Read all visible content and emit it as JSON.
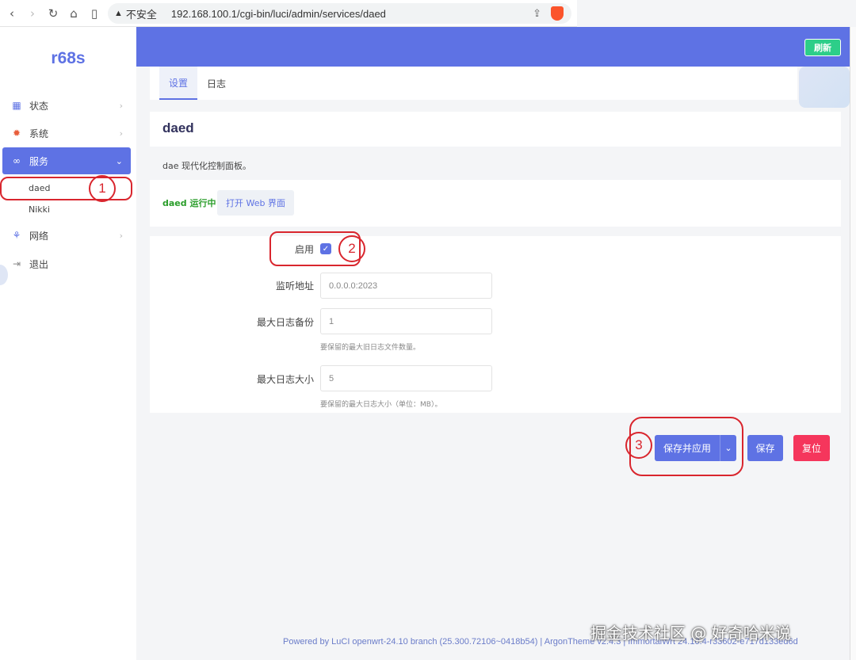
{
  "browser": {
    "insecure_label": "不安全",
    "url": "192.168.100.1/cgi-bin/luci/admin/services/daed"
  },
  "sidebar": {
    "logo": "r68s",
    "items": [
      {
        "label": "状态",
        "icon": "dashboard-icon"
      },
      {
        "label": "系统",
        "icon": "gear-icon"
      },
      {
        "label": "服务",
        "icon": "link-icon"
      },
      {
        "label": "网络",
        "icon": "sitemap-icon"
      },
      {
        "label": "退出",
        "icon": "logout-icon"
      }
    ],
    "sub_items": [
      {
        "label": "daed"
      },
      {
        "label": "Nikki"
      }
    ]
  },
  "header": {
    "refresh_label": "刷新"
  },
  "tabs": [
    {
      "label": "设置",
      "active": true
    },
    {
      "label": "日志",
      "active": false
    }
  ],
  "main": {
    "title": "daed",
    "description": "dae 现代化控制面板。",
    "status_text": "daed 运行中",
    "open_web_label": "打开 Web 界面",
    "form": {
      "enable_label": "启用",
      "enabled": true,
      "listen_label": "监听地址",
      "listen_value": "0.0.0.0:2023",
      "max_backups_label": "最大日志备份",
      "max_backups_value": "1",
      "max_backups_hint": "要保留的最大旧日志文件数量。",
      "max_size_label": "最大日志大小",
      "max_size_value": "5",
      "max_size_hint": "要保留的最大日志大小（单位：MB）。"
    },
    "buttons": {
      "save_apply": "保存并应用",
      "save": "保存",
      "reset": "复位"
    }
  },
  "annotations": [
    "1",
    "2",
    "3"
  ],
  "footer": "Powered by LuCI openwrt-24.10 branch (25.300.72106~0418b54)  |  ArgonTheme v2.4.3  |  ImmortalWrt 24.10.4-r33602-e717d133ed6d",
  "watermark": "掘金技术社区 @ 好奇哈米说",
  "colors": {
    "accent": "#5e72e4",
    "success": "#2dce89",
    "danger": "#f5365c",
    "annotation": "#d9262e"
  }
}
